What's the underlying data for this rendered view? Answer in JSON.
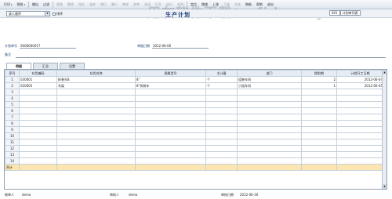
{
  "toolbar": {
    "items": [
      {
        "label": "打印",
        "caret": true,
        "dim": false
      },
      {
        "label": "预览",
        "caret": true,
        "dim": false
      },
      {
        "label": "输出",
        "caret": false,
        "dim": false
      },
      {
        "label": "过滤",
        "caret": false,
        "dim": false
      },
      {
        "label": "复制",
        "caret": false,
        "dim": true
      },
      {
        "label": "删除",
        "caret": false,
        "dim": true
      },
      {
        "label": "保存",
        "caret": false,
        "dim": true
      },
      {
        "label": "放弃",
        "caret": false,
        "dim": true
      },
      {
        "label": "增行",
        "caret": false,
        "dim": true
      },
      {
        "label": "删行",
        "caret": false,
        "dim": true
      },
      {
        "label": "审核",
        "caret": false,
        "dim": true
      },
      {
        "label": "弃审",
        "caret": false,
        "dim": true
      },
      {
        "label": "关闭",
        "caret": false,
        "dim": true
      },
      {
        "label": "打开",
        "caret": false,
        "dim": true
      },
      {
        "label": "执行",
        "caret": false,
        "dim": true
      },
      {
        "label": "合并",
        "caret": false,
        "dim": true
      },
      {
        "label": "定位",
        "caret": false,
        "dim": false
      },
      {
        "label": "增减",
        "caret": false,
        "dim": false
      },
      {
        "label": "上张",
        "caret": false,
        "dim": false
      },
      {
        "label": "下张",
        "caret": false,
        "dim": true
      },
      {
        "label": "末张",
        "caret": false,
        "dim": true
      },
      {
        "label": "刷新",
        "caret": false,
        "dim": false
      },
      {
        "label": "帮助",
        "caret": false,
        "dim": false
      },
      {
        "label": "退出",
        "caret": false,
        "dim": false
      }
    ]
  },
  "filter": {
    "sort_value": "录入顺序",
    "checkbox_label": "排序"
  },
  "title": "生产计划",
  "watermark": "用友软件下载：ufidasw yu.com",
  "right_box": {
    "value": "601",
    "caption": "计划单列表"
  },
  "header": {
    "plan_no_label": "计划单号",
    "plan_no": "0000000017",
    "date_label": "单据日期",
    "date": "2012-06-06",
    "remark_label": "备注"
  },
  "tabs": [
    "明细",
    "汇总",
    "设置"
  ],
  "table": {
    "columns": [
      "序号",
      "存货编码",
      "存货名称",
      "规格型号",
      "主计量",
      "部门",
      "提前期",
      "计划开工日期"
    ],
    "rows": [
      [
        "1",
        "030001",
        "拆装车8",
        "8\"",
        "个",
        "组装车间",
        "2",
        "2012-06-04"
      ],
      [
        "2",
        "020005",
        "车架",
        "8\"拆装车",
        "个",
        "小组车间",
        "1",
        "2012-06-05"
      ],
      [
        "3",
        "",
        "",
        "",
        "",
        "",
        "",
        ""
      ],
      [
        "4",
        "",
        "",
        "",
        "",
        "",
        "",
        ""
      ],
      [
        "5",
        "",
        "",
        "",
        "",
        "",
        "",
        ""
      ],
      [
        "6",
        "",
        "",
        "",
        "",
        "",
        "",
        ""
      ],
      [
        "7",
        "",
        "",
        "",
        "",
        "",
        "",
        ""
      ],
      [
        "8",
        "",
        "",
        "",
        "",
        "",
        "",
        ""
      ],
      [
        "9",
        "",
        "",
        "",
        "",
        "",
        "",
        ""
      ],
      [
        "10",
        "",
        "",
        "",
        "",
        "",
        "",
        ""
      ],
      [
        "11",
        "",
        "",
        "",
        "",
        "",
        "",
        ""
      ],
      [
        "12",
        "",
        "",
        "",
        "",
        "",
        "",
        ""
      ],
      [
        "13",
        "",
        "",
        "",
        "",
        "",
        "",
        ""
      ],
      [
        "14",
        "",
        "",
        "",
        "",
        "",
        "",
        ""
      ]
    ],
    "total_label": "合计"
  },
  "footer": {
    "maker_label": "制单人",
    "maker": "demo",
    "auditor_label": "审核人",
    "auditor": "demo",
    "audit_date_label": "审核日期",
    "audit_date": "2012-06-30"
  },
  "colors": {
    "title": "#1f3f7a",
    "total_row": "#fde5b0",
    "header_bg": "#e6ecf3"
  }
}
